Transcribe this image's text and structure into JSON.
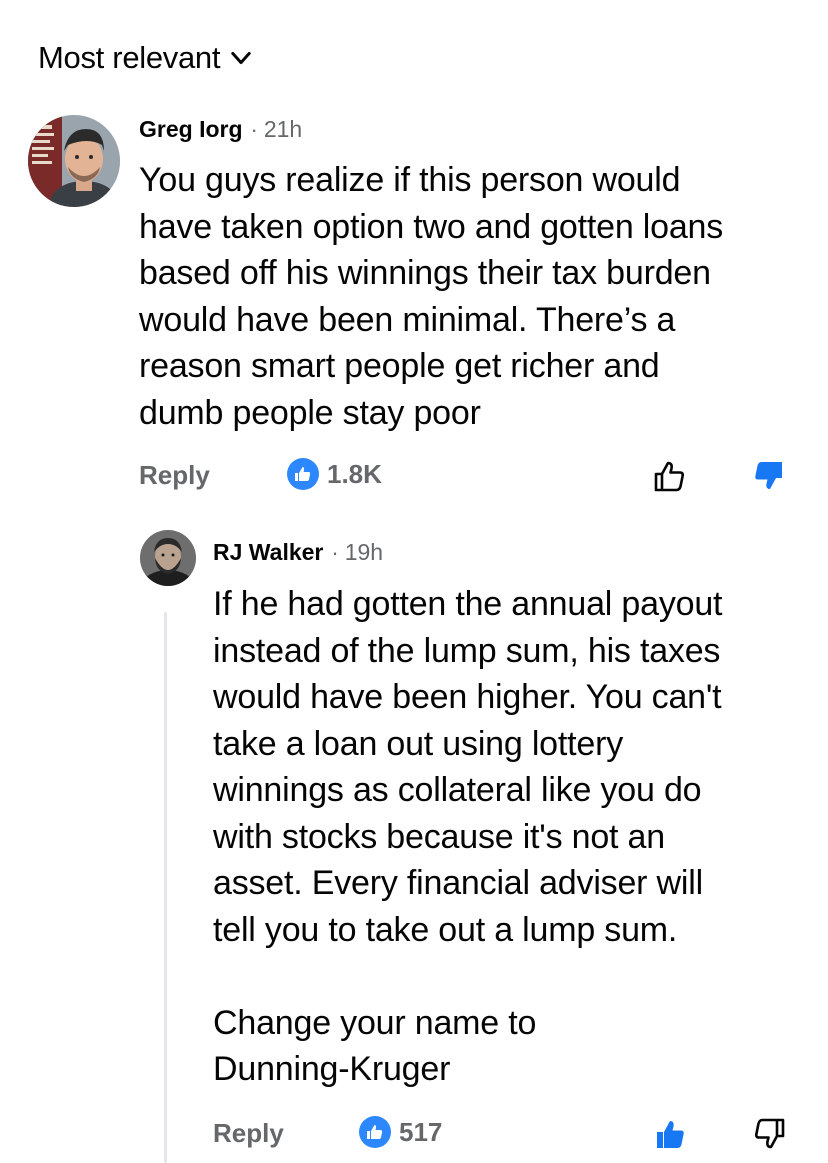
{
  "sort": {
    "label": "Most relevant",
    "icon": "chevron-down-icon"
  },
  "comments": [
    {
      "author": "Greg Iorg",
      "separator": "·",
      "time": "21h",
      "text": "You guys realize if this person would\nhave taken option two and gotten loans\nbased off his winnings their tax burden\nwould have been minimal. There’s a\nreason smart people get richer and\ndumb people stay poor",
      "reply_label": "Reply",
      "reaction_icon": "like-icon",
      "reaction_count": "1.8K",
      "upvote_icon": "thumbs-up-outline-icon",
      "downvote_icon": "thumbs-down-filled-icon",
      "upvoted": false,
      "downvoted": true
    },
    {
      "author": "RJ Walker",
      "separator": "·",
      "time": "19h",
      "text": "If he had gotten the annual payout\ninstead of the lump sum, his taxes\nwould have been higher. You can't\ntake a loan out using lottery\nwinnings as collateral like you do\nwith stocks because it's not an\nasset. Every financial adviser will\ntell you to take out a lump sum.\n\nChange your name to\nDunning-Kruger",
      "reply_label": "Reply",
      "reaction_icon": "like-icon",
      "reaction_count": "517",
      "upvote_icon": "thumbs-up-filled-icon",
      "downvote_icon": "thumbs-down-outline-icon",
      "upvoted": true,
      "downvoted": false
    }
  ],
  "colors": {
    "accent": "#1877f2",
    "reaction_blue": "#2d88ff",
    "muted_text": "#65676b",
    "text": "#050505"
  }
}
